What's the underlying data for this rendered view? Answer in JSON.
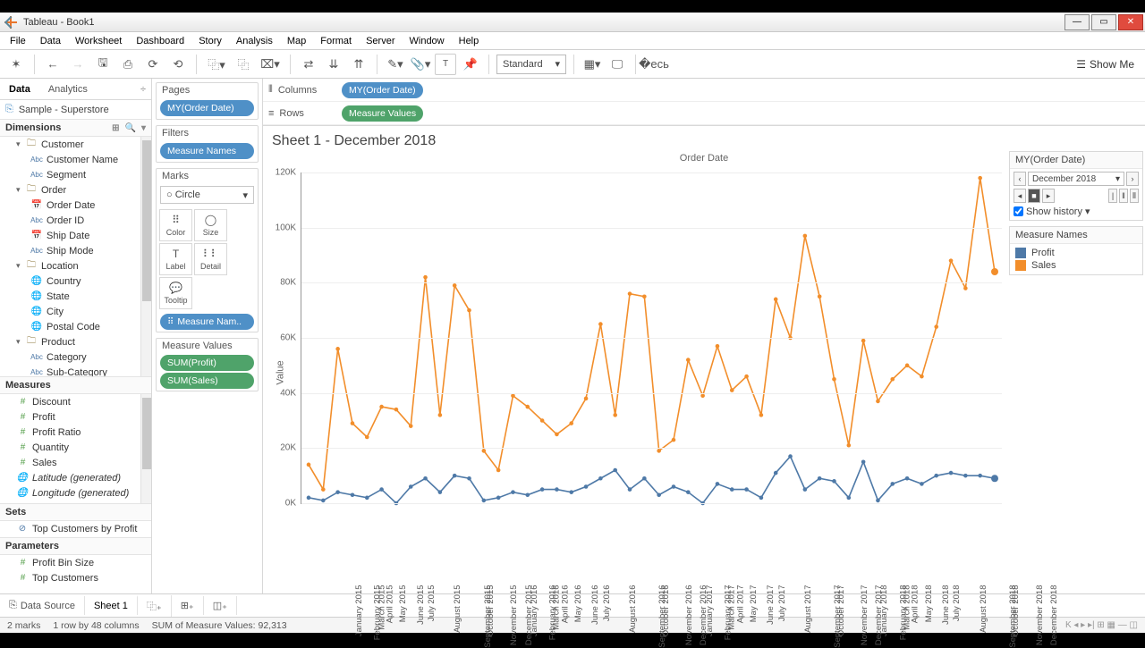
{
  "window": {
    "title": "Tableau - Book1"
  },
  "menu": [
    "File",
    "Data",
    "Worksheet",
    "Dashboard",
    "Story",
    "Analysis",
    "Map",
    "Format",
    "Server",
    "Window",
    "Help"
  ],
  "toolbar": {
    "fit": "Standard",
    "showme": "Show Me"
  },
  "sidepanel": {
    "tabs": {
      "data": "Data",
      "analytics": "Analytics"
    },
    "datasource": "Sample - Superstore",
    "dimensions_label": "Dimensions",
    "dimensions_groups": [
      {
        "name": "Customer",
        "items": [
          {
            "icon": "abc",
            "label": "Customer Name"
          },
          {
            "icon": "abc",
            "label": "Segment"
          }
        ]
      },
      {
        "name": "Order",
        "items": [
          {
            "icon": "date",
            "label": "Order Date"
          },
          {
            "icon": "abc",
            "label": "Order ID"
          },
          {
            "icon": "date",
            "label": "Ship Date"
          },
          {
            "icon": "abc",
            "label": "Ship Mode"
          }
        ]
      },
      {
        "name": "Location",
        "items": [
          {
            "icon": "geo",
            "label": "Country"
          },
          {
            "icon": "geo",
            "label": "State"
          },
          {
            "icon": "geo",
            "label": "City"
          },
          {
            "icon": "geo",
            "label": "Postal Code"
          }
        ]
      },
      {
        "name": "Product",
        "items": [
          {
            "icon": "abc",
            "label": "Category"
          },
          {
            "icon": "abc",
            "label": "Sub-Category"
          }
        ]
      }
    ],
    "measures_label": "Measures",
    "measures": [
      {
        "icon": "num",
        "label": "Discount"
      },
      {
        "icon": "num",
        "label": "Profit"
      },
      {
        "icon": "num",
        "label": "Profit Ratio"
      },
      {
        "icon": "num",
        "label": "Quantity"
      },
      {
        "icon": "num",
        "label": "Sales"
      },
      {
        "icon": "geo",
        "label": "Latitude (generated)",
        "italic": true
      },
      {
        "icon": "geo",
        "label": "Longitude (generated)",
        "italic": true
      }
    ],
    "sets_label": "Sets",
    "sets": [
      {
        "icon": "set",
        "label": "Top Customers by Profit"
      }
    ],
    "params_label": "Parameters",
    "params": [
      {
        "icon": "num",
        "label": "Profit Bin Size"
      },
      {
        "icon": "num",
        "label": "Top Customers"
      }
    ]
  },
  "cards": {
    "pages_label": "Pages",
    "pages_pill": "MY(Order Date)",
    "filters_label": "Filters",
    "filters_pill": "Measure Names",
    "marks_label": "Marks",
    "marks_type": "Circle",
    "mark_btns": [
      "Color",
      "Size",
      "Label",
      "Detail",
      "Tooltip"
    ],
    "marks_pill": "Measure Nam..",
    "mv_label": "Measure Values",
    "mv_pills": [
      "SUM(Profit)",
      "SUM(Sales)"
    ]
  },
  "shelves": {
    "columns_label": "Columns",
    "columns_pill": "MY(Order Date)",
    "rows_label": "Rows",
    "rows_pill": "Measure Values"
  },
  "sheet": {
    "title": "Sheet 1 - December 2018",
    "axis_title_top": "Order Date",
    "ylabel": "Value"
  },
  "page_control": {
    "title": "MY(Order Date)",
    "current": "December 2018",
    "show_history": "Show history"
  },
  "legend": {
    "title": "Measure Names",
    "items": [
      {
        "label": "Profit",
        "color": "#4e79a7"
      },
      {
        "label": "Sales",
        "color": "#f28e2b"
      }
    ]
  },
  "tabs": {
    "datasource": "Data Source",
    "sheet": "Sheet 1"
  },
  "status": {
    "marks": "2 marks",
    "rowcol": "1 row by 48 columns",
    "sum": "SUM of Measure Values: 92,313"
  },
  "chart_data": {
    "type": "line",
    "title": "Order Date",
    "xlabel": "",
    "ylabel": "Value",
    "ylim": [
      0,
      120000
    ],
    "yticks": [
      0,
      20000,
      40000,
      60000,
      80000,
      100000,
      120000
    ],
    "ytick_labels": [
      "0K",
      "20K",
      "40K",
      "60K",
      "80K",
      "100K",
      "120K"
    ],
    "categories": [
      "January 2015",
      "February 2015",
      "March 2015",
      "April 2015",
      "May 2015",
      "June 2015",
      "July 2015",
      "August 2015",
      "September 2015",
      "October 2015",
      "November 2015",
      "December 2015",
      "January 2016",
      "February 2016",
      "March 2016",
      "April 2016",
      "May 2016",
      "June 2016",
      "July 2016",
      "August 2016",
      "September 2016",
      "October 2016",
      "November 2016",
      "December 2016",
      "January 2017",
      "February 2017",
      "March 2017",
      "April 2017",
      "May 2017",
      "June 2017",
      "July 2017",
      "August 2017",
      "September 2017",
      "October 2017",
      "November 2017",
      "December 2017",
      "January 2018",
      "February 2018",
      "March 2018",
      "April 2018",
      "May 2018",
      "June 2018",
      "July 2018",
      "August 2018",
      "September 2018",
      "October 2018",
      "November 2018",
      "December 2018"
    ],
    "series": [
      {
        "name": "Sales",
        "color": "#f28e2b",
        "values": [
          14000,
          5000,
          56000,
          29000,
          24000,
          35000,
          34000,
          28000,
          82000,
          32000,
          79000,
          70000,
          19000,
          12000,
          39000,
          35000,
          30000,
          25000,
          29000,
          38000,
          65000,
          32000,
          76000,
          75000,
          19000,
          23000,
          52000,
          39000,
          57000,
          41000,
          46000,
          32000,
          74000,
          60000,
          97000,
          75000,
          45000,
          21000,
          59000,
          37000,
          45000,
          50000,
          46000,
          64000,
          88000,
          78000,
          118000,
          84000
        ]
      },
      {
        "name": "Profit",
        "color": "#4e79a7",
        "values": [
          2000,
          1000,
          4000,
          3000,
          2000,
          5000,
          0,
          6000,
          9000,
          4000,
          10000,
          9000,
          1000,
          2000,
          4000,
          3000,
          5000,
          5000,
          4000,
          6000,
          9000,
          12000,
          5000,
          9000,
          3000,
          6000,
          4000,
          0,
          7000,
          5000,
          5000,
          2000,
          11000,
          17000,
          5000,
          9000,
          8000,
          2000,
          15000,
          1000,
          7000,
          9000,
          7000,
          10000,
          11000,
          10000,
          10000,
          9000
        ]
      }
    ]
  }
}
